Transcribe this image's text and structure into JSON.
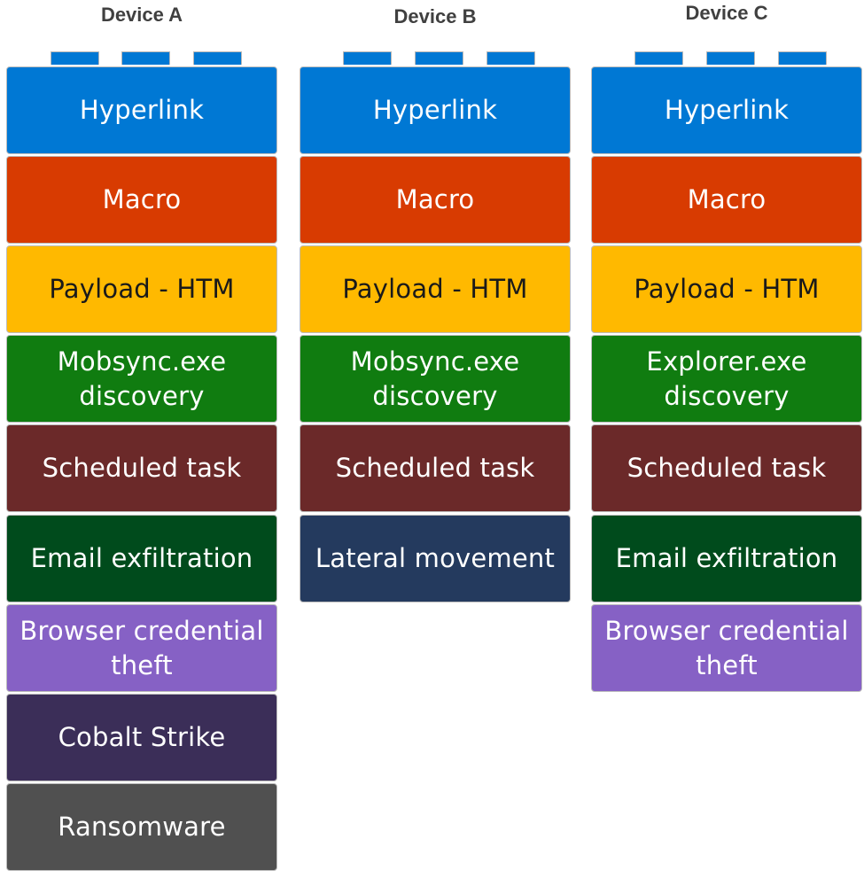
{
  "colors": {
    "hyperlink": "#0078d4",
    "macro": "#d83b01",
    "payload": "#ffb900",
    "discovery": "#107c10",
    "scheduled_task": "#6b2929",
    "email_exfiltration": "#004b1c",
    "browser_credential_theft": "#8661c5",
    "cobalt_strike": "#3b2e58",
    "ransomware": "#505050",
    "lateral_movement": "#243a5e",
    "dark_text": "#1a1a1a",
    "light_text": "#ffffff"
  },
  "devices": [
    {
      "title": "Device A",
      "blocks": [
        {
          "label": "Hyperlink",
          "color_key": "hyperlink"
        },
        {
          "label": "Macro",
          "color_key": "macro"
        },
        {
          "label": "Payload - HTM",
          "color_key": "payload"
        },
        {
          "label": "Mobsync.exe\ndiscovery",
          "color_key": "discovery"
        },
        {
          "label": "Scheduled task",
          "color_key": "scheduled_task"
        },
        {
          "label": "Email exfiltration",
          "color_key": "email_exfiltration"
        },
        {
          "label": "Browser credential\ntheft",
          "color_key": "browser_credential_theft"
        },
        {
          "label": "Cobalt Strike",
          "color_key": "cobalt_strike"
        },
        {
          "label": "Ransomware",
          "color_key": "ransomware"
        }
      ]
    },
    {
      "title": "Device B",
      "blocks": [
        {
          "label": "Hyperlink",
          "color_key": "hyperlink"
        },
        {
          "label": "Macro",
          "color_key": "macro"
        },
        {
          "label": "Payload - HTM",
          "color_key": "payload"
        },
        {
          "label": "Mobsync.exe\ndiscovery",
          "color_key": "discovery"
        },
        {
          "label": "Scheduled task",
          "color_key": "scheduled_task"
        },
        {
          "label": "Lateral movement",
          "color_key": "lateral_movement"
        }
      ]
    },
    {
      "title": "Device C",
      "blocks": [
        {
          "label": "Hyperlink",
          "color_key": "hyperlink"
        },
        {
          "label": "Macro",
          "color_key": "macro"
        },
        {
          "label": "Payload - HTM",
          "color_key": "payload"
        },
        {
          "label": "Explorer.exe\ndiscovery",
          "color_key": "discovery"
        },
        {
          "label": "Scheduled task",
          "color_key": "scheduled_task"
        },
        {
          "label": "Email exfiltration",
          "color_key": "email_exfiltration"
        },
        {
          "label": "Browser credential\ntheft",
          "color_key": "browser_credential_theft"
        }
      ]
    }
  ]
}
